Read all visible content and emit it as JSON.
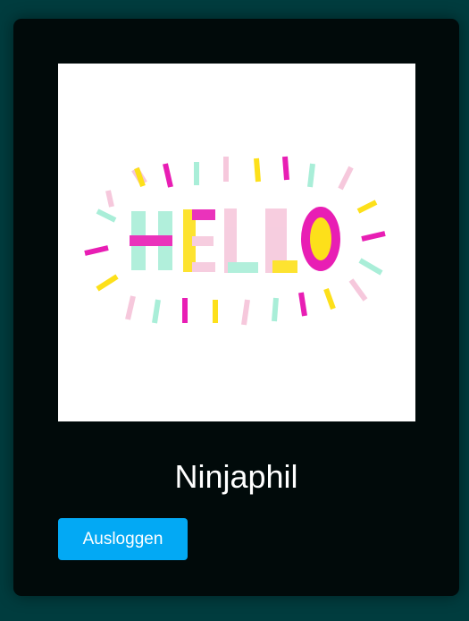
{
  "profile": {
    "username": "Ninjaphil",
    "avatar_alt": "HELLO",
    "avatar_icon": "hello-lettering-image"
  },
  "actions": {
    "logout_label": "Ausloggen"
  },
  "colors": {
    "page_background": "#003c3e",
    "card_background": "#010a0a",
    "button_background": "#03a9f4",
    "text": "#ffffff",
    "artwork_pink": "#e81eb4",
    "artwork_light_pink": "#f6c8dc",
    "artwork_yellow": "#fde01a",
    "artwork_mint": "#a9eed8"
  }
}
